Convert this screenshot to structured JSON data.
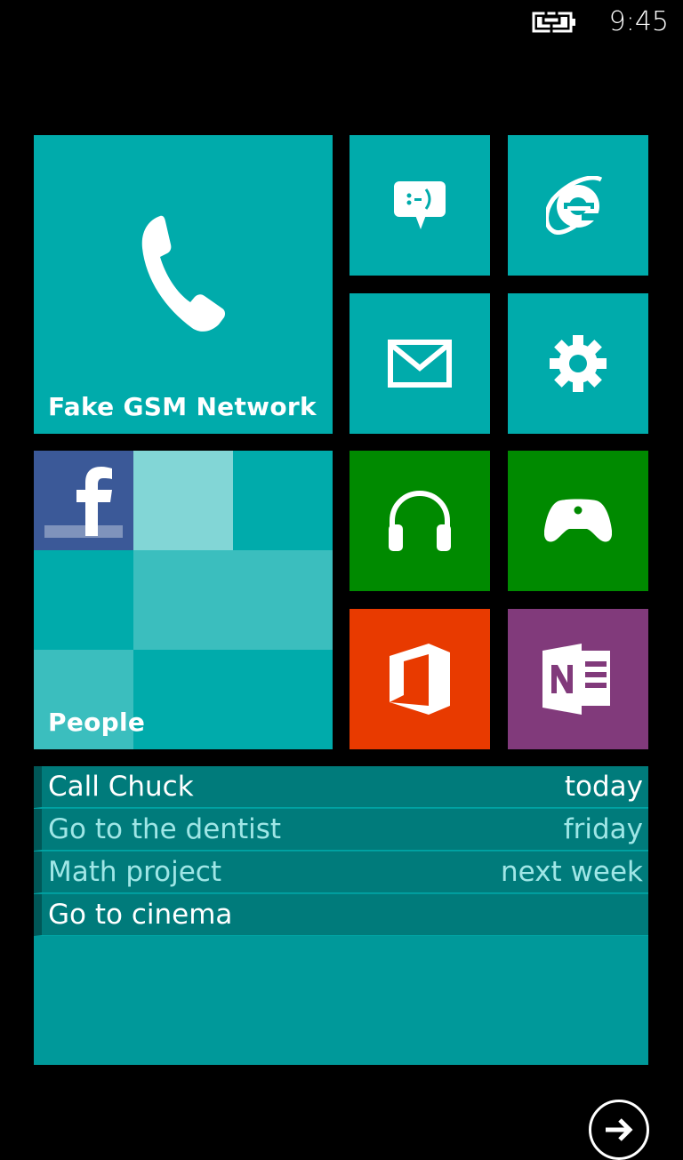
{
  "status_bar": {
    "time": "9:45",
    "battery_icon": "battery-charging-icon"
  },
  "tiles": {
    "phone": {
      "label": "Fake GSM Network",
      "icon": "phone-icon",
      "color": "#00abab"
    },
    "messaging": {
      "icon": "messaging-icon",
      "color": "#00abab"
    },
    "internet_explorer": {
      "icon": "internet-explorer-icon",
      "color": "#00abab"
    },
    "mail": {
      "icon": "mail-icon",
      "color": "#00abab"
    },
    "settings": {
      "icon": "gear-icon",
      "color": "#00abab"
    },
    "people": {
      "label": "People",
      "icon": "facebook-icon",
      "color": "#00abab"
    },
    "music": {
      "icon": "headphones-icon",
      "color": "#008a00"
    },
    "games": {
      "icon": "game-controller-icon",
      "color": "#008a00"
    },
    "office": {
      "icon": "office-icon",
      "color": "#e83a00"
    },
    "onenote": {
      "icon": "onenote-icon",
      "color": "#813a7b"
    }
  },
  "tasks": [
    {
      "title": "Call Chuck",
      "due": "today"
    },
    {
      "title": "Go to the dentist",
      "due": "friday"
    },
    {
      "title": "Math project",
      "due": "next week"
    },
    {
      "title": "Go to cinema",
      "due": ""
    }
  ],
  "navigation": {
    "icon": "arrow-right-icon"
  }
}
